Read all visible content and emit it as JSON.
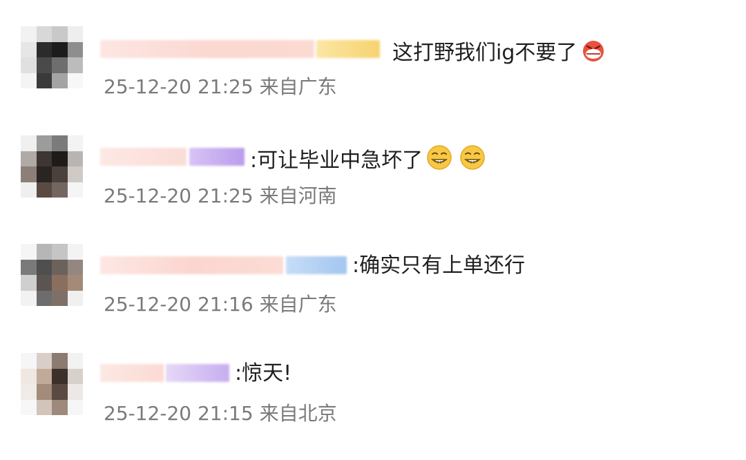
{
  "comments": [
    {
      "text": "这打野我们ig不要了",
      "emoji": [
        "angry-grin-emoji"
      ],
      "time": "25-12-20 21:25",
      "location": "来自广东"
    },
    {
      "text": ":可让毕业中急坏了",
      "emoji": [
        "smirk-grin-emoji",
        "smirk-grin-emoji"
      ],
      "time": "25-12-20 21:25",
      "location": "来自河南"
    },
    {
      "text": ":确实只有上单还行",
      "emoji": [],
      "time": "25-12-20 21:16",
      "location": "来自广东"
    },
    {
      "text": ":惊天!",
      "emoji": [],
      "time": "25-12-20 21:15",
      "location": "来自北京"
    }
  ],
  "colors": {
    "text": "#1f1f1f",
    "meta": "#7a7a7a"
  }
}
